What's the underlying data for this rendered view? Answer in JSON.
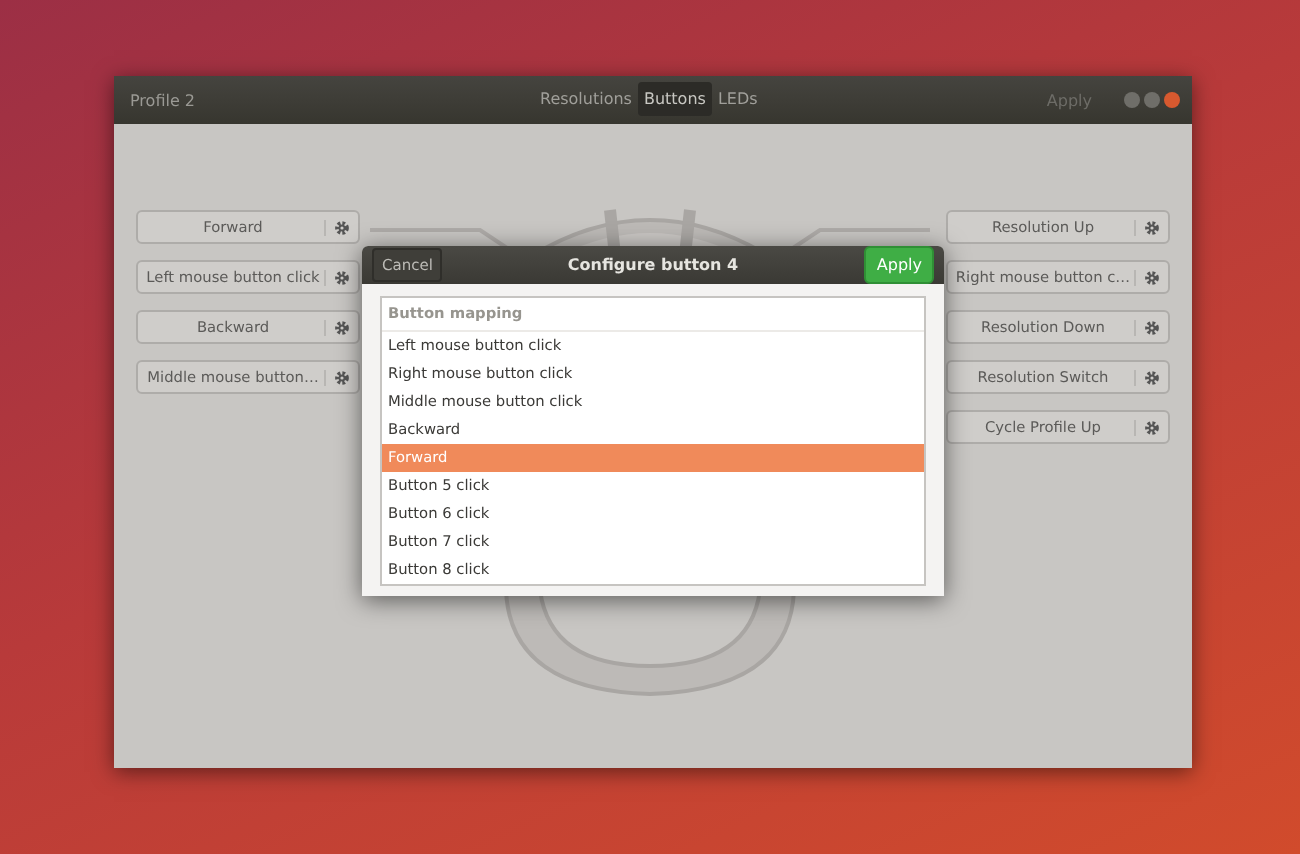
{
  "window": {
    "title": "Profile 2",
    "apply": {
      "label": "Apply",
      "disabled": true
    }
  },
  "tabs": [
    {
      "label": "Resolutions",
      "selected": false
    },
    {
      "label": "Buttons",
      "selected": true
    },
    {
      "label": "LEDs",
      "selected": false
    }
  ],
  "left_buttons": [
    {
      "label": "Forward"
    },
    {
      "label": "Left mouse button click"
    },
    {
      "label": "Backward"
    },
    {
      "label": "Middle mouse button…"
    }
  ],
  "right_buttons": [
    {
      "label": "Resolution Up"
    },
    {
      "label": "Right mouse button c…"
    },
    {
      "label": "Resolution Down"
    },
    {
      "label": "Resolution Switch"
    },
    {
      "label": "Cycle Profile Up"
    }
  ],
  "dialog": {
    "title": "Configure button 4",
    "cancel": "Cancel",
    "apply": "Apply",
    "list_header": "Button mapping",
    "items": [
      {
        "label": "Left mouse button click",
        "selected": false
      },
      {
        "label": "Right mouse button click",
        "selected": false
      },
      {
        "label": "Middle mouse button click",
        "selected": false
      },
      {
        "label": "Backward",
        "selected": false
      },
      {
        "label": "Forward",
        "selected": true
      },
      {
        "label": "Button 5 click",
        "selected": false
      },
      {
        "label": "Button 6 click",
        "selected": false
      },
      {
        "label": "Button 7 click",
        "selected": false
      },
      {
        "label": "Button 8 click",
        "selected": false
      }
    ]
  }
}
